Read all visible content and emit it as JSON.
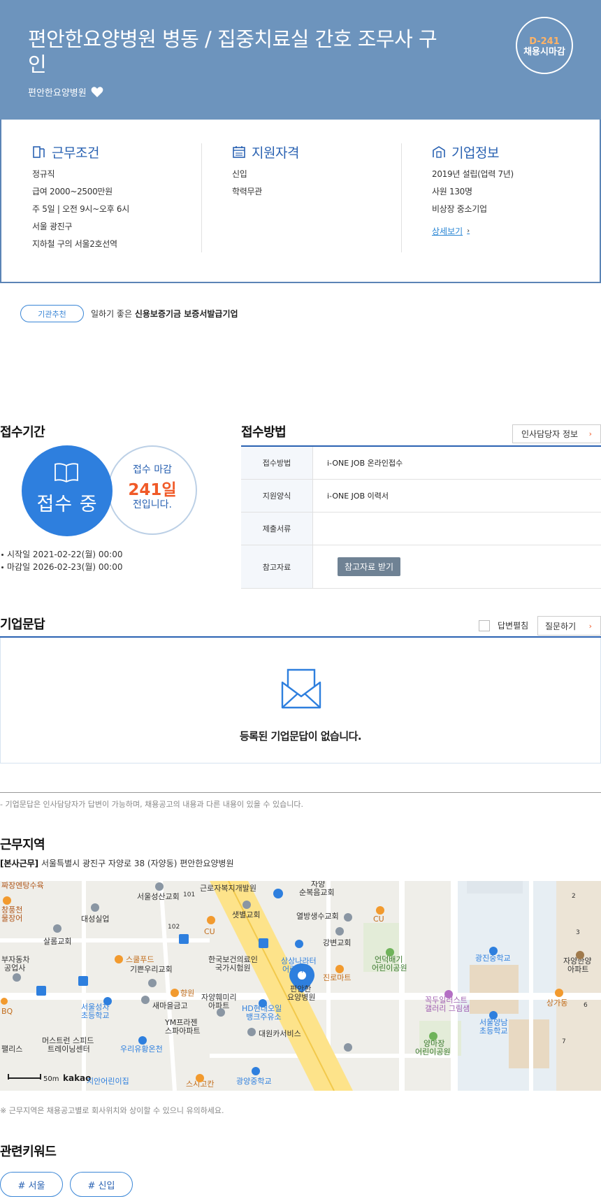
{
  "header": {
    "title": "편안한요양병원 병동 / 집중치료실 간호 조무사 구인",
    "company": "편안한요양병원",
    "dday": "D-241",
    "dday_label": "채용시마감"
  },
  "conditions": {
    "title": "근무조건",
    "lines": [
      "정규직",
      "급여 2000~2500만원",
      "주 5일 | 오전 9시~오후 6시",
      "서울 광진구",
      "지하철 구의 서울2호선역"
    ]
  },
  "qualification": {
    "title": "지원자격",
    "lines": [
      "신입",
      "학력무관"
    ]
  },
  "company_info": {
    "title": "기업정보",
    "lines": [
      "2019년 설립(업력 7년)",
      "사원 130명",
      "비상장 중소기업"
    ],
    "more": "상세보기"
  },
  "recommend": {
    "tag": "기관추천",
    "prefix": "일하기 좋은",
    "bold": "신용보증기금 보증서발급기업"
  },
  "period": {
    "title": "접수기간",
    "status": "접수 중",
    "remain_l1": "접수 마감",
    "remain_days": "241일",
    "remain_l3": "전입니다.",
    "start": "시작일 2021-02-22(월) 00:00",
    "end": "마감일 2026-02-23(월) 00:00"
  },
  "method": {
    "title": "접수방법",
    "hr_button": "인사담당자 정보",
    "rows": [
      {
        "key": "접수방법",
        "value": "i-ONE JOB 온라인접수"
      },
      {
        "key": "지원양식",
        "value": "i-ONE JOB 이력서"
      },
      {
        "key": "제출서류",
        "value": ""
      },
      {
        "key": "참고자료",
        "value": ""
      }
    ],
    "ref_button": "참고자료 받기"
  },
  "qa": {
    "title": "기업문답",
    "toggle_label": "답변펼침",
    "ask_button": "질문하기",
    "empty": "등록된 기업문답이 없습니다.",
    "note": "- 기업문답은 인사담당자가 답변이 가능하며, 채용공고의 내용과 다른 내용이 있을 수 있습니다."
  },
  "region": {
    "title": "근무지역",
    "tag": "[본사근무]",
    "address": "서울특별시 광진구 자양로 38 (자양동) 편안한요양병원",
    "note": "※ 근무지역은 채용공고별로 회사위치와 상이할 수 있으니 유의하세요.",
    "map_labels": {
      "l01": "짜장엔탕수육",
      "l02": "서울성산교회",
      "l03": "근로자복지개발원",
      "l04": "자양",
      "l05": "순복음교회",
      "l06": "창풍천",
      "l07": "물장어",
      "l08": "대성실업",
      "l09": "샛별교회",
      "l10": "열방생수교회",
      "l11": "살롬교회",
      "l12": "강변교회",
      "l13": "상상나라터",
      "l14": "어린이집",
      "l15": "광진중학교",
      "l16": "자양한양",
      "l17": "아파트",
      "l18": "부자동차",
      "l19": "공업사",
      "l20": "스쿨푸드",
      "l21": "기쁜우리교회",
      "l22": "한국보건의료인",
      "l23": "국가시험원",
      "l24": "언덕배기",
      "l25": "어린이공원",
      "l26": "진로마트",
      "l27": "편안한",
      "l28": "요양병원",
      "l29": "향원",
      "l30": "자양훼미리",
      "l31": "아파트",
      "l32": "서울성자",
      "l33": "초등학교",
      "l34": "새마을금고",
      "l35": "HD현대오일",
      "l36": "뱅크주유소",
      "l37": "꼭두일러스트",
      "l38": "갤러리 그림샘",
      "l39": "상가동",
      "l40": "서울양남",
      "l41": "초등학교",
      "l42": "YM프라젠",
      "l43": "스파아파트",
      "l44": "대원카서비스",
      "l45": "머스트런 스피드",
      "l46": "트레이닝센터",
      "l47": "우리유황온천",
      "l48": "양마장",
      "l49": "어린이공원",
      "l50": "팰리스",
      "l51": "지안어린이집",
      "l52": "스시고칸",
      "l53": "광양중학교",
      "l54": "CU",
      "l55": "CU",
      "l56": "BQ",
      "l57": "101",
      "l58": "102",
      "l59": "2",
      "l60": "3",
      "l61": "6",
      "l62": "7",
      "scale": "50m",
      "brand": "kakao"
    }
  },
  "keywords": {
    "title": "관련키워드",
    "items": [
      "# 서울",
      "# 신입"
    ]
  }
}
